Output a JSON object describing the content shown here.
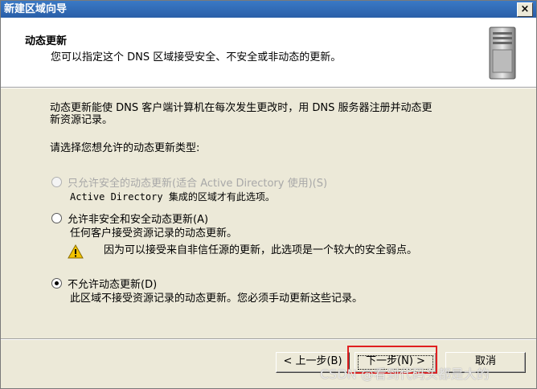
{
  "window": {
    "title": "新建区域向导",
    "close_label": "×"
  },
  "header": {
    "title": "动态更新",
    "subtitle": "您可以指定这个 DNS 区域接受安全、不安全或非动态的更新。",
    "icon": "server-icon"
  },
  "body": {
    "intro_line1": "动态更新能使 DNS 客户端计算机在每次发生更改时，用 DNS 服务器注册并动态更",
    "intro_line2": "新资源记录。",
    "prompt": "请选择您想允许的动态更新类型:",
    "options": [
      {
        "label": "只允许安全的动态更新(适合 Active Directory 使用)(S)",
        "note": "Active Directory 集成的区域才有此选项。",
        "enabled": false,
        "checked": false
      },
      {
        "label": "允许非安全和安全动态更新(A)",
        "note": "任何客户接受资源记录的动态更新。",
        "warning": "因为可以接受来自非信任源的更新，此选项是一个较大的安全弱点。",
        "enabled": true,
        "checked": false
      },
      {
        "label": "不允许动态更新(D)",
        "note": "此区域不接受资源记录的动态更新。您必须手动更新这些记录。",
        "enabled": true,
        "checked": true
      }
    ]
  },
  "buttons": {
    "back": "< 上一步(B)",
    "next": "下一步(N) >",
    "cancel": "取消"
  },
  "watermark": "CSDN @看到代码头都是大的",
  "colors": {
    "title_bar": "#2a5fa8",
    "dialog_bg": "#ece9d8",
    "highlight": "#e02020",
    "warning": "#f2c300"
  }
}
